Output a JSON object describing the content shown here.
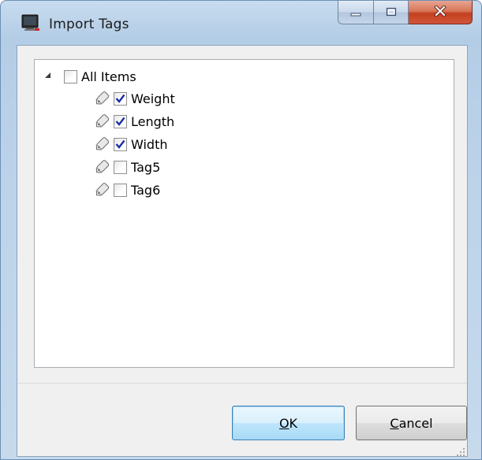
{
  "window": {
    "title": "Import Tags",
    "caption_buttons": [
      "minimize",
      "maximize",
      "close"
    ]
  },
  "tree": {
    "root": {
      "label": "All Items",
      "checked": false,
      "expanded": true
    },
    "items": [
      {
        "label": "Weight",
        "checked": true,
        "icon": "tag-icon"
      },
      {
        "label": "Length",
        "checked": true,
        "icon": "tag-icon"
      },
      {
        "label": "Width",
        "checked": true,
        "icon": "tag-icon"
      },
      {
        "label": "Tag5",
        "checked": false,
        "icon": "tag-icon"
      },
      {
        "label": "Tag6",
        "checked": false,
        "icon": "tag-icon"
      }
    ]
  },
  "buttons": {
    "ok": {
      "label": "OK",
      "access_key": "O",
      "rest": "K"
    },
    "cancel": {
      "label": "Cancel",
      "access_key": "C",
      "rest": "ancel"
    }
  },
  "colors": {
    "check_mark": "#1a2fa8",
    "close_button": "#c2401f",
    "default_button_border": "#3c7fb1"
  }
}
